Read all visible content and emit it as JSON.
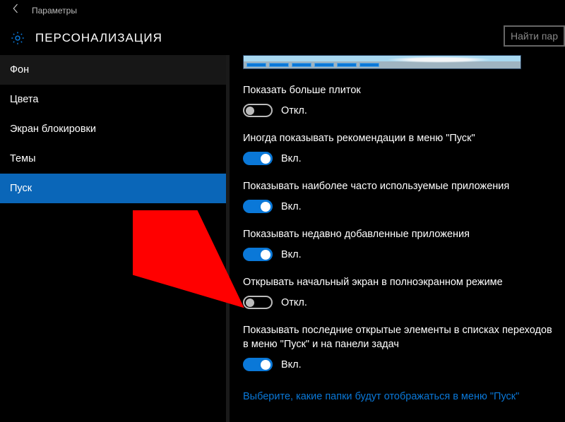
{
  "window": {
    "title": "Параметры"
  },
  "header": {
    "category": "ПЕРСОНАЛИЗАЦИЯ",
    "search_placeholder": "Найти пар"
  },
  "sidebar": {
    "items": [
      {
        "label": "Фон"
      },
      {
        "label": "Цвета"
      },
      {
        "label": "Экран блокировки"
      },
      {
        "label": "Темы"
      },
      {
        "label": "Пуск"
      }
    ],
    "selected_index": 4
  },
  "toggle_states": {
    "on": "Вкл.",
    "off": "Откл."
  },
  "settings": [
    {
      "label": "Показать больше плиток",
      "value": false
    },
    {
      "label": "Иногда показывать рекомендации в меню \"Пуск\"",
      "value": true
    },
    {
      "label": "Показывать наиболее часто используемые приложения",
      "value": true
    },
    {
      "label": "Показывать недавно добавленные приложения",
      "value": true
    },
    {
      "label": "Открывать начальный экран в полноэкранном режиме",
      "value": false
    },
    {
      "label": "Показывать последние открытые элементы в списках переходов в меню \"Пуск\" и на панели задач",
      "value": true
    }
  ],
  "link": "Выберите, какие папки будут отображаться в меню \"Пуск\"",
  "annotation": {
    "target_setting_index": 4,
    "color": "#ff0000"
  }
}
